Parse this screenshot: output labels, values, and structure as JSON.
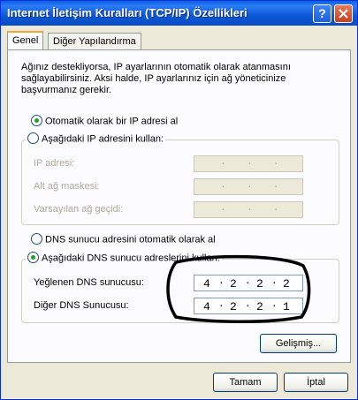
{
  "window": {
    "title": "Internet İletişim Kuralları (TCP/IP) Özellikleri",
    "help_glyph": "?"
  },
  "tabs": [
    {
      "label": "Genel"
    },
    {
      "label": "Diğer Yapılandırma"
    }
  ],
  "intro_text": "Ağınız destekliyorsa, IP ayarlarının otomatik olarak atanmasını sağlayabilirsiniz. Aksi halde, IP ayarlarınız için ağ yöneticinize başvurmanız gerekir.",
  "ip_section": {
    "auto_option": "Otomatik olarak bir IP adresi al",
    "auto_selected": true,
    "manual_option": "Aşağıdaki IP adresini kullan:",
    "fields": [
      {
        "label": "IP adresi:",
        "value": [
          "",
          "",
          "",
          ""
        ]
      },
      {
        "label": "Alt ağ maskesi:",
        "value": [
          "",
          "",
          "",
          ""
        ]
      },
      {
        "label": "Varsayılan ağ geçidi:",
        "value": [
          "",
          "",
          "",
          ""
        ]
      }
    ]
  },
  "dns_section": {
    "auto_option": "DNS sunucu adresini otomatik olarak al",
    "manual_option": "Aşağıdaki DNS sunucu adreslerini kullan:",
    "manual_selected": true,
    "fields": [
      {
        "label": "Yeğlenen DNS sunucusu:",
        "octets": [
          "4",
          "2",
          "2",
          "2"
        ]
      },
      {
        "label": "Diğer DNS Sunucusu:",
        "octets": [
          "4",
          "2",
          "2",
          "1"
        ]
      }
    ]
  },
  "buttons": {
    "advanced": "Gelişmiş...",
    "ok": "Tamam",
    "cancel": "İptal"
  },
  "colors": {
    "title_bar": "#0a5fe6",
    "selected_radio": "#21a121",
    "annotation": "#000000"
  }
}
